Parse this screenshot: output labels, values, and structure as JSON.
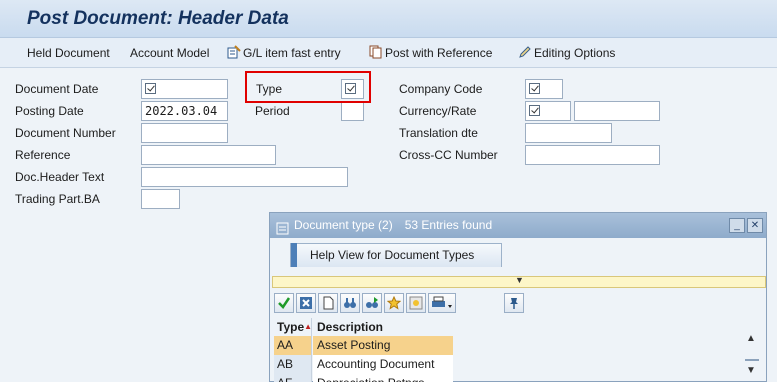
{
  "window": {
    "title": "Post Document: Header Data"
  },
  "toolbar": {
    "held_document": "Held Document",
    "account_model": "Account Model",
    "gl_fast_entry": "G/L item fast entry",
    "post_with_reference": "Post with Reference",
    "editing_options": "Editing Options"
  },
  "form": {
    "document_date": {
      "label": "Document Date",
      "value": ""
    },
    "posting_date": {
      "label": "Posting Date",
      "value": "2022.03.04"
    },
    "document_number": {
      "label": "Document Number",
      "value": ""
    },
    "reference": {
      "label": "Reference",
      "value": ""
    },
    "doc_header_text": {
      "label": "Doc.Header Text",
      "value": ""
    },
    "trading_part_ba": {
      "label": "Trading Part.BA",
      "value": ""
    },
    "type": {
      "label": "Type",
      "value": ""
    },
    "period": {
      "label": "Period",
      "value": ""
    },
    "company_code": {
      "label": "Company Code",
      "value": ""
    },
    "currency_rate": {
      "label": "Currency/Rate",
      "value": ""
    },
    "translation_dte": {
      "label": "Translation dte",
      "value": ""
    },
    "cross_cc_number": {
      "label": "Cross-CC Number",
      "value": ""
    }
  },
  "popup": {
    "title": "Document type (2)",
    "entries_found": "53 Entries found",
    "tab_label": "Help View for Document Types",
    "columns": {
      "type": "Type",
      "description": "Description"
    },
    "rows": [
      {
        "type": "AA",
        "description": "Asset Posting",
        "selected": true
      },
      {
        "type": "AB",
        "description": "Accounting Document",
        "selected": false
      },
      {
        "type": "AF",
        "description": "Depreciation Pstngs",
        "selected": false
      }
    ]
  },
  "colors": {
    "title_text": "#14325e",
    "highlight_border": "#e00000",
    "selected_row": "#f6d28c",
    "popup_header": "#8eabcb"
  }
}
